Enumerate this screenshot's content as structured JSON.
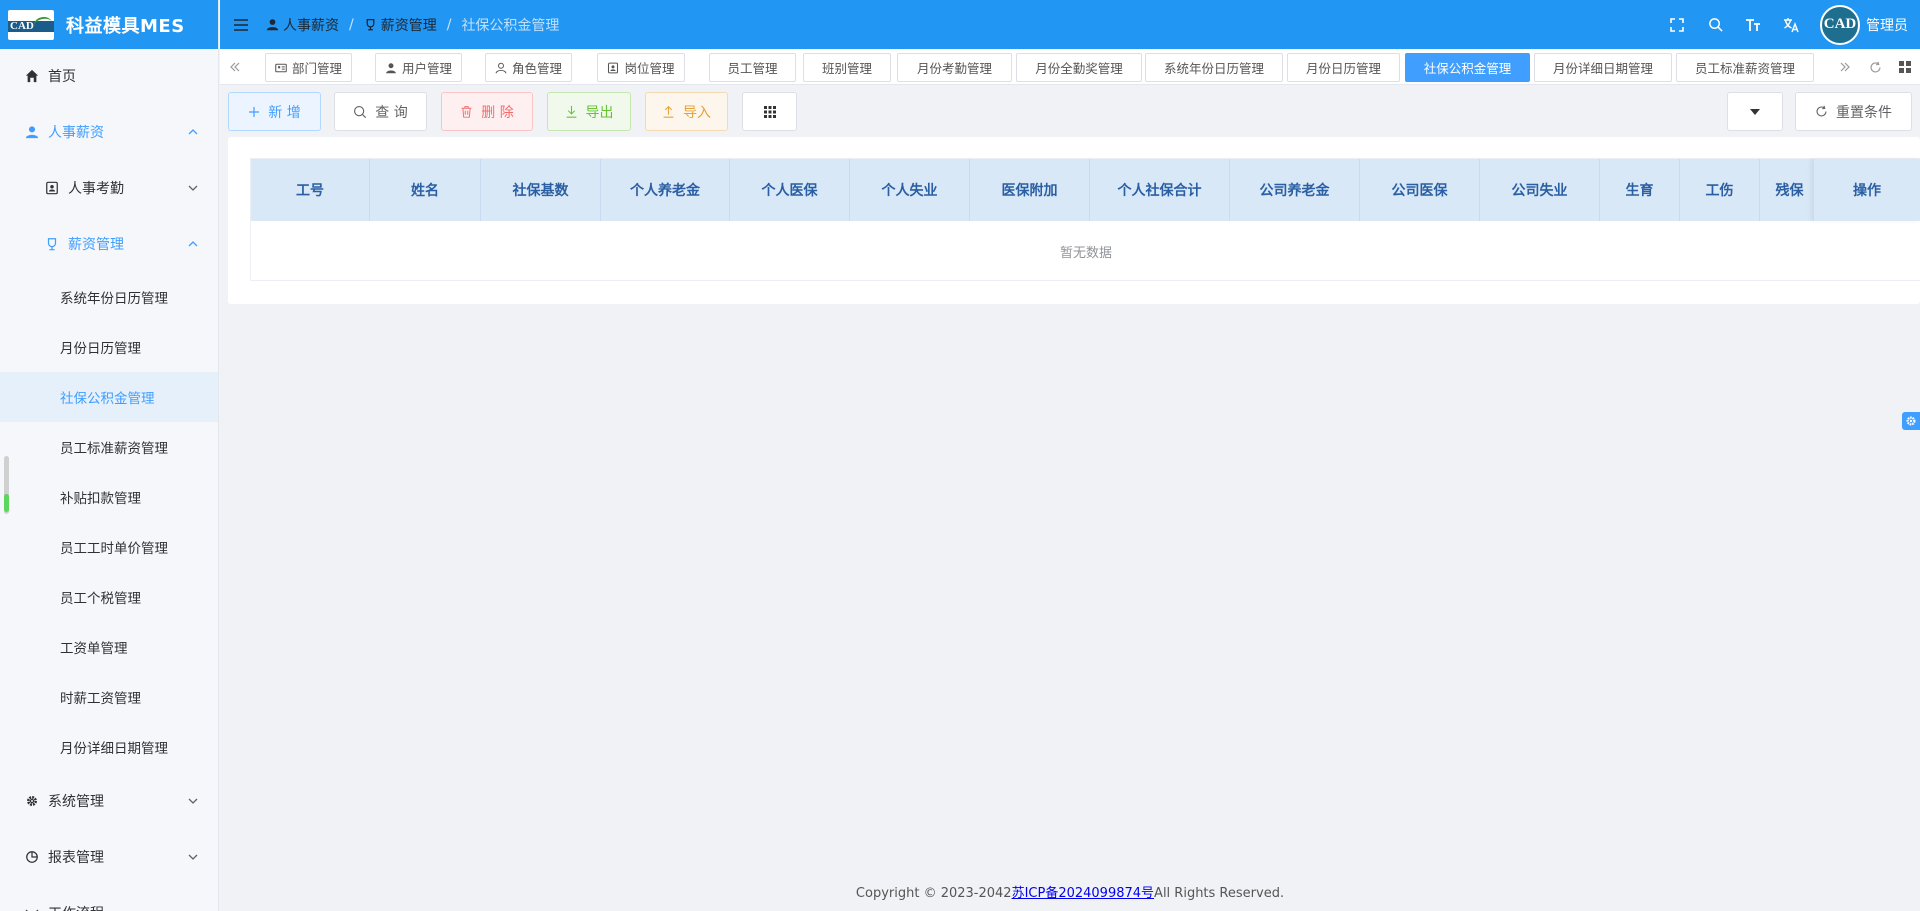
{
  "app": {
    "logo_text": "CAD",
    "title": "科益模具MES"
  },
  "sidebar": {
    "items": [
      {
        "label": "首页",
        "icon": "home-icon"
      },
      {
        "label": "人事薪资",
        "icon": "user-icon",
        "expanded": true
      },
      {
        "label": "人事考勤",
        "icon": "id-card-icon",
        "expanded": false
      },
      {
        "label": "薪资管理",
        "icon": "trophy-icon",
        "expanded": true
      },
      {
        "label": "系统年份日历管理"
      },
      {
        "label": "月份日历管理"
      },
      {
        "label": "社保公积金管理",
        "selected": true
      },
      {
        "label": "员工标准薪资管理"
      },
      {
        "label": "补贴扣款管理"
      },
      {
        "label": "员工工时单价管理"
      },
      {
        "label": "员工个税管理"
      },
      {
        "label": "工资单管理"
      },
      {
        "label": "时薪工资管理"
      },
      {
        "label": "月份详细日期管理"
      },
      {
        "label": "系统管理",
        "icon": "gear-icon",
        "expanded": false
      },
      {
        "label": "报表管理",
        "icon": "pie-chart-icon",
        "expanded": false
      },
      {
        "label": "工作流程",
        "icon": "workflow-icon"
      }
    ]
  },
  "header": {
    "breadcrumb": [
      "人事薪资",
      "薪资管理",
      "社保公积金管理"
    ],
    "avatar_text": "CAD",
    "username": "管理员"
  },
  "tabs": [
    {
      "label": "部门管理",
      "icon": "id-card-icon"
    },
    {
      "label": "用户管理",
      "icon": "user-icon"
    },
    {
      "label": "角色管理",
      "icon": "user-outline-icon"
    },
    {
      "label": "岗位管理",
      "icon": "post-icon"
    },
    {
      "label": "员工管理"
    },
    {
      "label": "班别管理"
    },
    {
      "label": "月份考勤管理"
    },
    {
      "label": "月份全勤奖管理"
    },
    {
      "label": "系统年份日历管理"
    },
    {
      "label": "月份日历管理"
    },
    {
      "label": "社保公积金管理",
      "active": true
    },
    {
      "label": "月份详细日期管理"
    },
    {
      "label": "员工标准薪资管理"
    }
  ],
  "toolbar": {
    "add_label": "新 增",
    "query_label": "查 询",
    "delete_label": "删 除",
    "export_label": "导出",
    "import_label": "导入",
    "reset_label": "重置条件"
  },
  "table": {
    "columns": [
      "工号",
      "姓名",
      "社保基数",
      "个人养老金",
      "个人医保",
      "个人失业",
      "医保附加",
      "个人社保合计",
      "公司养老金",
      "公司医保",
      "公司失业",
      "生育",
      "工伤",
      "残保",
      "操作"
    ],
    "rows": [],
    "empty_text": "暂无数据"
  },
  "footer": {
    "prefix": "Copyright © 2023-2042",
    "link": "苏ICP备2024099874号",
    "suffix": "All Rights Reserved."
  },
  "colors": {
    "primary": "#2196f3",
    "accent": "#409eff",
    "danger": "#f56c6c",
    "success": "#67c23a",
    "warning": "#e6a23c"
  }
}
